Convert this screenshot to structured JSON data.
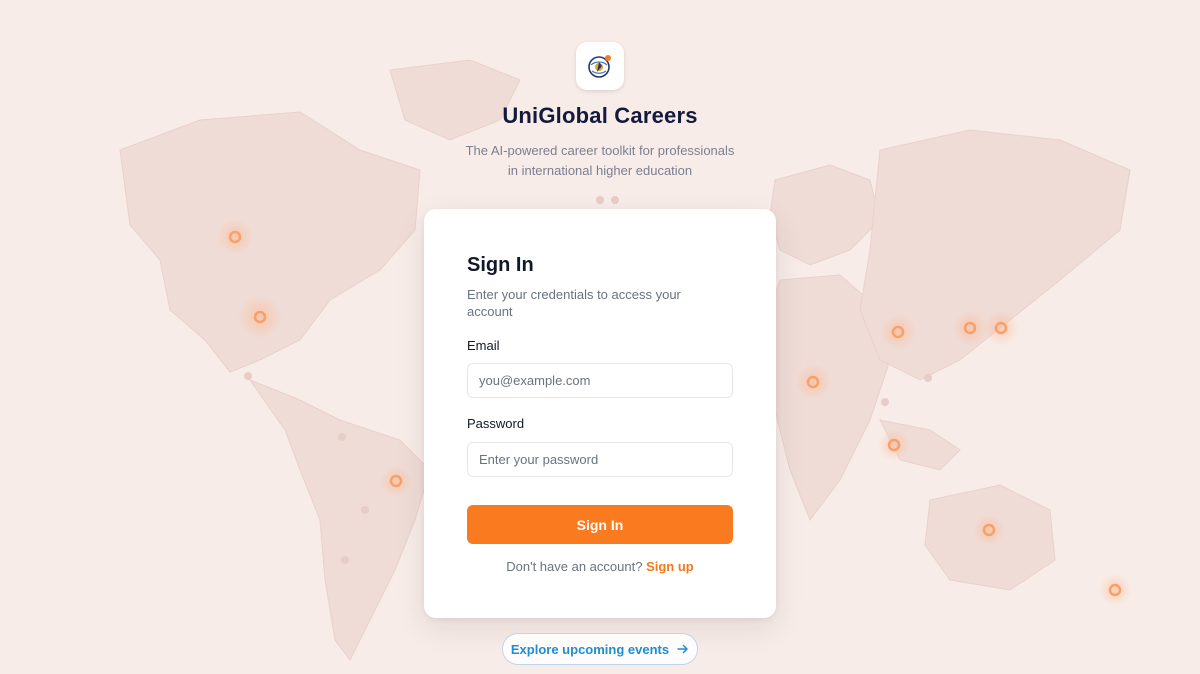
{
  "brand": {
    "title": "UniGlobal Careers",
    "tagline_line1": "The AI-powered career toolkit for professionals",
    "tagline_line2": "in international higher education",
    "logo_icon": "globe-icon"
  },
  "signin": {
    "title": "Sign In",
    "subtitle": "Enter your credentials to access your account",
    "email_label": "Email",
    "email_placeholder": "you@example.com",
    "email_value": "",
    "password_label": "Password",
    "password_placeholder": "Enter your password",
    "password_value": "",
    "submit_label": "Sign In",
    "signup_prompt": "Don't have an account?",
    "signup_link": "Sign up"
  },
  "events": {
    "label": "Explore upcoming events",
    "icon": "arrow-right-icon"
  },
  "colors": {
    "accent": "#f97a1f",
    "background": "#f7ece8",
    "title": "#141a3d",
    "link": "#1d8fd1"
  }
}
